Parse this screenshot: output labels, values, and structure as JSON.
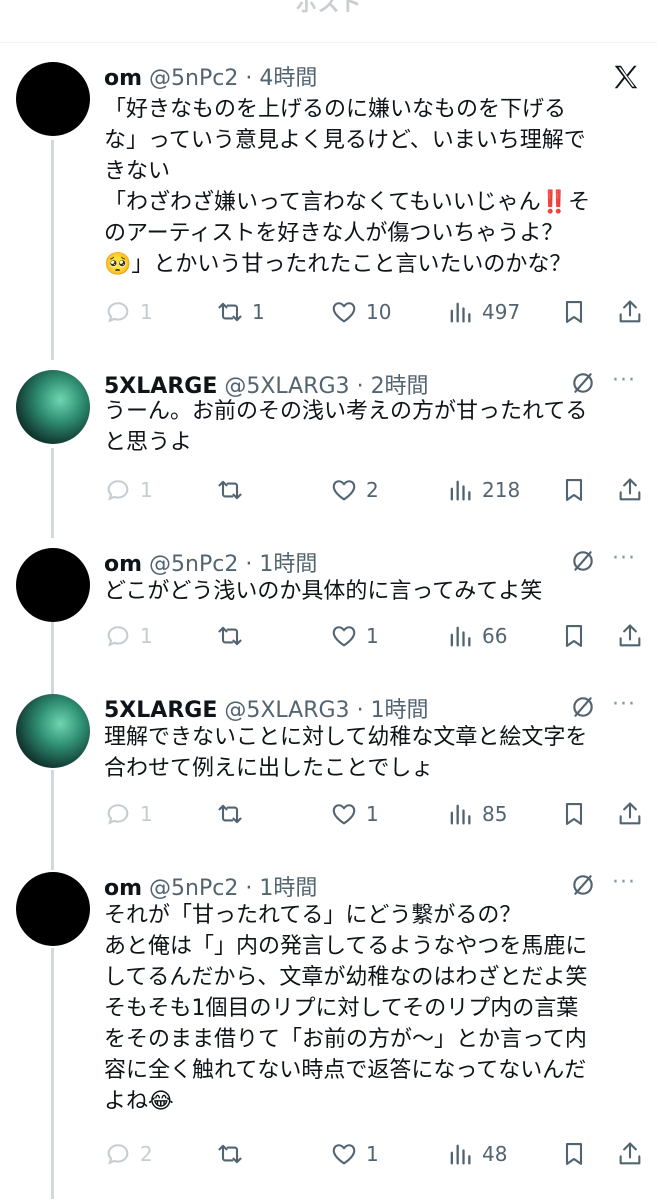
{
  "top_title": "ポスト",
  "tweets": [
    {
      "name": "om",
      "handle": "@5nPc2",
      "time": "4時間",
      "lines": [
        "「好きなものを上げるのに嫌いなものを下げる",
        "な」っていう意見よく見るけど、いまいち理解で",
        "きない",
        "「わざわざ嫌いって言わなくてもいいじゃん‼️そ",
        "のアーティストを好きな人が傷ついちゃうよ？",
        "🥺」とかいう甘ったれたこと言いたいのかな？"
      ],
      "replies": "1",
      "retweets": "1",
      "likes": "10",
      "views": "497"
    },
    {
      "name": "5XLARGE",
      "handle": "@5XLARG3",
      "time": "2時間",
      "lines": [
        "うーん。お前のその浅い考えの方が甘ったれてる",
        "と思うよ"
      ],
      "replies": "1",
      "retweets": "",
      "likes": "2",
      "views": "218"
    },
    {
      "name": "om",
      "handle": "@5nPc2",
      "time": "1時間",
      "lines": [
        "どこがどう浅いのか具体的に言ってみてよ笑"
      ],
      "replies": "1",
      "retweets": "",
      "likes": "1",
      "views": "66"
    },
    {
      "name": "5XLARGE",
      "handle": "@5XLARG3",
      "time": "1時間",
      "lines": [
        "理解できないことに対して幼稚な文章と絵文字を",
        "合わせて例えに出したことでしょ"
      ],
      "replies": "1",
      "retweets": "",
      "likes": "1",
      "views": "85"
    },
    {
      "name": "om",
      "handle": "@5nPc2",
      "time": "1時間",
      "lines": [
        "それが「甘ったれてる」にどう繋がるの？",
        "あと俺は「」内の発言してるようなやつを馬鹿に",
        "してるんだから、文章が幼稚なのはわざとだよ笑",
        "そもそも1個目のリプに対してそのリプ内の言葉",
        "をそのまま借りて「お前の方が〜」とか言って内",
        "容に全く触れてない時点で返答になってないんだ",
        "よね😂"
      ],
      "replies": "2",
      "retweets": "",
      "likes": "1",
      "views": "48"
    }
  ],
  "icons": {
    "logo": "x-logo-icon",
    "unfollow": "slashed-circle-icon",
    "more": "more-dots-icon",
    "reply": "reply-bubble-icon",
    "retweet": "retweet-icon",
    "like": "heart-icon",
    "views": "views-bars-icon",
    "bookmark": "bookmark-icon",
    "share": "share-icon"
  }
}
